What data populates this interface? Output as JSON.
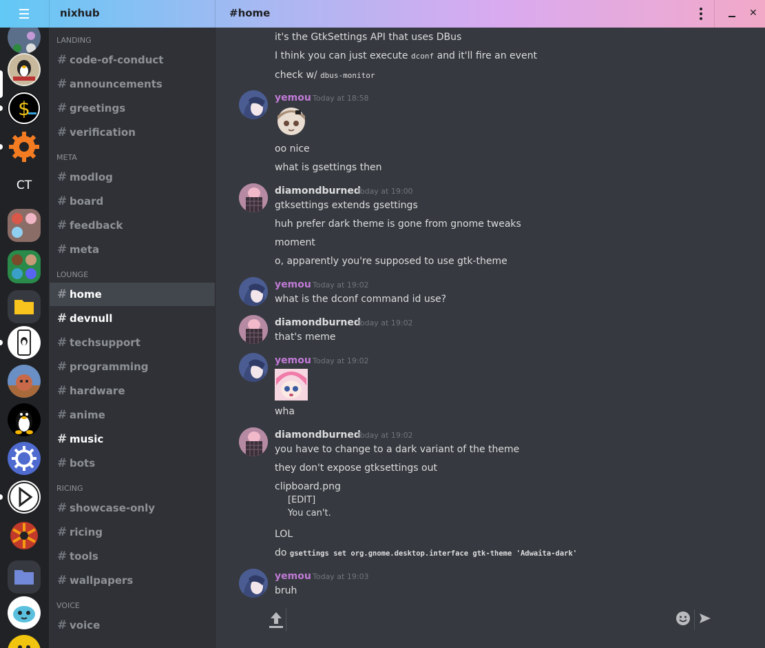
{
  "titlebar": {
    "server_name": "nixhub",
    "channel_title": "#home"
  },
  "guilds": {
    "text_guild": "CT"
  },
  "channels": {
    "categories": [
      {
        "label": "LANDING",
        "items": [
          "code-of-conduct",
          "announcements",
          "greetings",
          "verification"
        ]
      },
      {
        "label": "META",
        "items": [
          "modlog",
          "board",
          "feedback",
          "meta"
        ]
      },
      {
        "label": "LOUNGE",
        "items": [
          "home",
          "devnull",
          "techsupport",
          "programming",
          "hardware",
          "anime",
          "music",
          "bots"
        ]
      },
      {
        "label": "RICING",
        "items": [
          "showcase-only",
          "ricing",
          "tools",
          "wallpapers"
        ]
      },
      {
        "label": "VOICE",
        "items": [
          "voice"
        ]
      }
    ],
    "selected": "home",
    "unread": [
      "devnull",
      "music"
    ]
  },
  "messages": {
    "cont": {
      "l1": "it's the GtkSettings API that uses DBus",
      "l2a": "I think you can just execute ",
      "l2code": "dconf",
      "l2b": " and it'll fire an event",
      "l3a": "check w/ ",
      "l3code": "dbus-monitor"
    },
    "g1": {
      "author": "yemou",
      "time": "Today at 18:58",
      "lines": [
        "oo nice",
        "what is gsettings then"
      ]
    },
    "g2": {
      "author": "diamondburned",
      "time": "Today at 19:00",
      "lines": [
        "gtksettings extends gsettings",
        "huh prefer dark theme is gone from gnome tweaks",
        "moment",
        "o, apparently you're supposed to use gtk-theme"
      ]
    },
    "g3": {
      "author": "yemou",
      "time": "Today at 19:02",
      "lines": [
        "what is the dconf command id use?"
      ]
    },
    "g4": {
      "author": "diamondburned",
      "time": "Today at 19:02",
      "lines": [
        "that's meme"
      ]
    },
    "g5": {
      "author": "yemou",
      "time": "Today at 19:02",
      "lines": [
        "wha"
      ]
    },
    "g6": {
      "author": "diamondburned",
      "time": "Today at 19:02",
      "lines": [
        "you have to change to a dark variant of the theme",
        "they don't expose gtksettings out",
        "clipboard.png"
      ],
      "quote1": "[EDIT]",
      "quote2": "You can't.",
      "lol": "LOL",
      "do": "do ",
      "do_code": "gsettings set org.gnome.desktop.interface gtk-theme 'Adwaita-dark'"
    },
    "g7": {
      "author": "yemou",
      "time": "Today at 19:03",
      "lines": [
        "bruh"
      ]
    }
  },
  "composer": {
    "placeholder": ""
  }
}
